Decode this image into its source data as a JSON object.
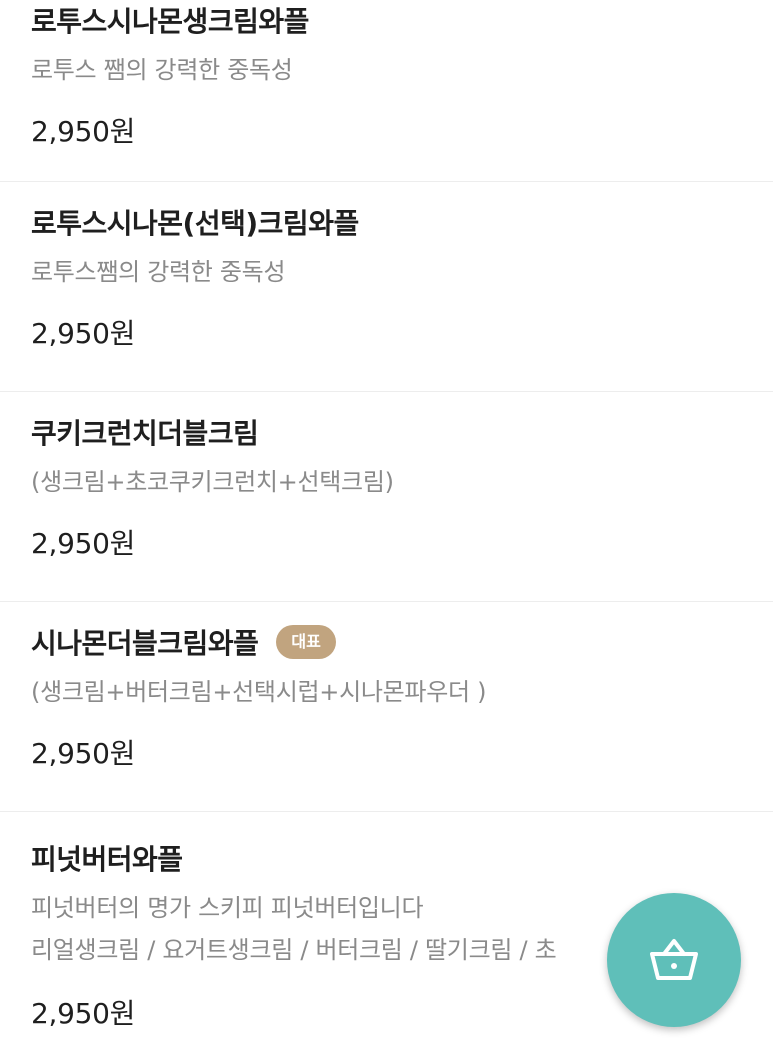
{
  "menu": {
    "items": [
      {
        "name": "로투스시나몬생크림와플",
        "badge": "",
        "descriptions": [
          "로투스 쨈의 강력한 중독성"
        ],
        "price": "2,950원"
      },
      {
        "name": "로투스시나몬(선택)크림와플",
        "badge": "",
        "descriptions": [
          "로투스쨈의 강력한 중독성"
        ],
        "price": "2,950원"
      },
      {
        "name": "쿠키크런치더블크림",
        "badge": "",
        "descriptions": [
          "(생크림+초코쿠키크런치+선택크림)"
        ],
        "price": "2,950원"
      },
      {
        "name": "시나몬더블크림와플",
        "badge": "대표",
        "descriptions": [
          "(생크림+버터크림+선택시럽+시나몬파우더 )"
        ],
        "price": "2,950원"
      },
      {
        "name": "피넛버터와플",
        "badge": "",
        "descriptions": [
          "피넛버터의 명가 스키피 피넛버터입니다",
          "리얼생크림 / 요거트생크림 / 버터크림 / 딸기크림 / 초"
        ],
        "price": "2,950원"
      }
    ]
  },
  "cart_button": {
    "icon": "basket-icon",
    "color": "#5fbfb9"
  },
  "colors": {
    "badge": "#c1a47f",
    "description": "#8a8a8a",
    "text": "#1f1f1f",
    "divider": "#ededed"
  }
}
